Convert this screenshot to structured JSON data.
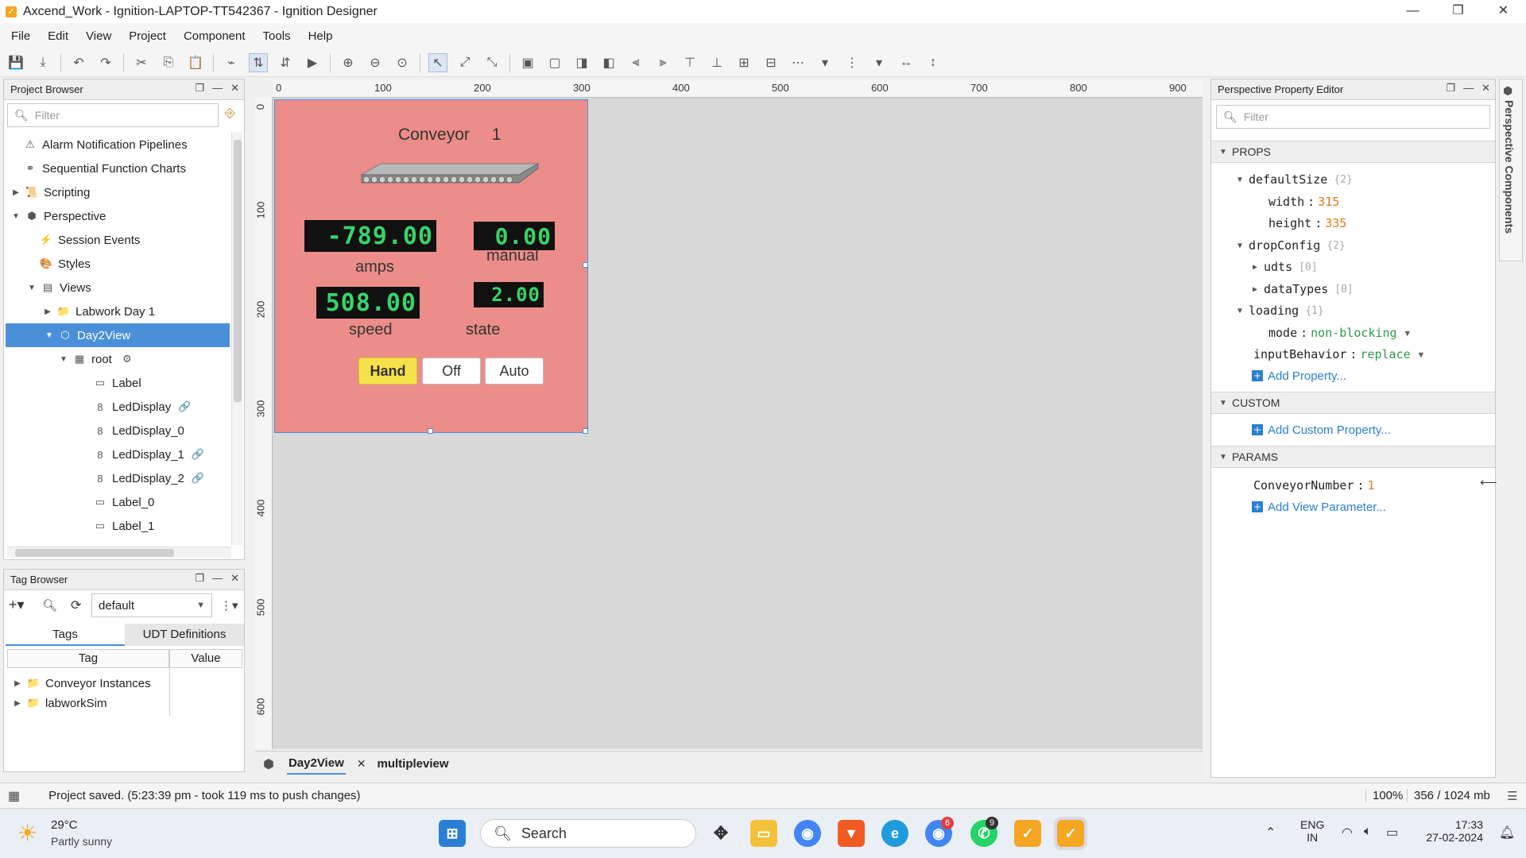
{
  "window": {
    "title": "Axcend_Work - Ignition-LAPTOP-TT542367 - Ignition Designer",
    "minimize": "—",
    "restore": "❐",
    "close": "✕"
  },
  "menu": [
    "File",
    "Edit",
    "View",
    "Project",
    "Component",
    "Tools",
    "Help"
  ],
  "project_browser": {
    "title": "Project Browser",
    "filter_placeholder": "Filter",
    "items": [
      {
        "label": "Alarm Notification Pipelines",
        "icon": "alarm-pipeline-icon"
      },
      {
        "label": "Sequential Function Charts",
        "icon": "sfc-icon"
      },
      {
        "label": "Scripting",
        "icon": "scripting-icon"
      },
      {
        "label": "Perspective",
        "icon": "perspective-icon"
      },
      {
        "label": "Session Events",
        "icon": "session-events-icon"
      },
      {
        "label": "Styles",
        "icon": "styles-icon"
      },
      {
        "label": "Views",
        "icon": "views-icon"
      },
      {
        "label": "Labwork Day 1",
        "icon": "folder-icon"
      },
      {
        "label": "Day2View",
        "icon": "view-icon"
      },
      {
        "label": "root",
        "icon": "container-icon"
      },
      {
        "label": "Label",
        "icon": "label-icon"
      },
      {
        "label": "LedDisplay",
        "icon": "led-display-icon"
      },
      {
        "label": "LedDisplay_0",
        "icon": "led-display-icon"
      },
      {
        "label": "LedDisplay_1",
        "icon": "led-display-icon"
      },
      {
        "label": "LedDisplay_2",
        "icon": "led-display-icon"
      },
      {
        "label": "Label_0",
        "icon": "label-icon"
      },
      {
        "label": "Label_1",
        "icon": "label-icon"
      }
    ]
  },
  "tag_browser": {
    "title": "Tag Browser",
    "provider": "default",
    "tabs": [
      "Tags",
      "UDT Definitions"
    ],
    "columns": [
      "Tag",
      "Value"
    ],
    "rows": [
      "Conveyor Instances",
      "labworkSim"
    ]
  },
  "ruler": {
    "top": [
      "0",
      "100",
      "200",
      "300",
      "400",
      "500",
      "600",
      "700",
      "800",
      "900"
    ],
    "left": [
      "0",
      "100",
      "200",
      "300",
      "400",
      "500",
      "600"
    ]
  },
  "view": {
    "title_text": "Conveyor",
    "conveyor_number": "1",
    "leds": {
      "amps": "-789.00",
      "manual": "0.00",
      "speed": "508.00",
      "state": "2.00"
    },
    "labels": {
      "amps": "amps",
      "manual": "manual",
      "speed": "speed",
      "state": "state"
    },
    "buttons": {
      "hand": "Hand",
      "off": "Off",
      "auto": "Auto"
    },
    "colors": {
      "background": "#ec8d8a",
      "led_text": "#37d46b",
      "hand_active": "#f5e14a"
    }
  },
  "doc_tabs": [
    {
      "label": "Day2View",
      "close": "✕"
    },
    {
      "label": "multipleview"
    }
  ],
  "property_editor": {
    "title": "Perspective Property Editor",
    "filter_placeholder": "Filter",
    "sections": {
      "props": "PROPS",
      "custom": "CUSTOM",
      "params": "PARAMS"
    },
    "props": {
      "defaultSize": "defaultSize",
      "defaultSize_count": "{2}",
      "width_key": "width",
      "width_val": "315",
      "height_key": "height",
      "height_val": "335",
      "dropConfig": "dropConfig",
      "dropConfig_count": "{2}",
      "udts": "udts",
      "udts_count": "[0]",
      "dataTypes": "dataTypes",
      "dataTypes_count": "[0]",
      "loading": "loading",
      "loading_count": "{1}",
      "mode_key": "mode",
      "mode_val": "non-blocking",
      "inputBehavior_key": "inputBehavior",
      "inputBehavior_val": "replace",
      "add_property": "Add Property..."
    },
    "custom": {
      "add": "Add Custom Property..."
    },
    "params": {
      "key": "ConveyorNumber",
      "val": "1",
      "add": "Add View Parameter..."
    },
    "side_tab": "Perspective Components"
  },
  "status": {
    "message": "Project saved. (5:23:39 pm - took 119 ms to push changes)",
    "zoom": "100%",
    "memory": "356 / 1024 mb"
  },
  "taskbar": {
    "weather_temp": "29°C",
    "weather_desc": "Partly sunny",
    "search_label": "Search",
    "lang_top": "ENG",
    "lang_bottom": "IN",
    "time": "17:33",
    "date": "27-02-2024",
    "badge_chrome": "6",
    "badge_whatsapp": "9"
  }
}
